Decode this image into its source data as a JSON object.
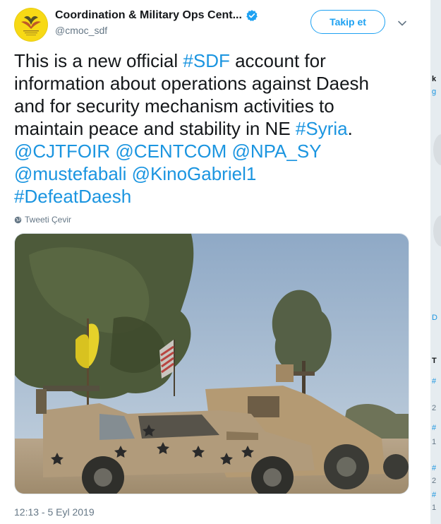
{
  "account": {
    "display_name": "Coordination & Military Ops Cent...",
    "handle": "@cmoc_sdf",
    "verified": true,
    "avatar_text": "Coordination & Military Ops Center"
  },
  "follow_button": {
    "label": "Takip et"
  },
  "icons": {
    "verified": "verified-badge-icon",
    "more": "chevron-down-icon",
    "translate": "globe-icon"
  },
  "tweet": {
    "lines": [
      [
        {
          "t": "This is a new official ",
          "link": false
        },
        {
          "t": "#SDF",
          "link": true
        },
        {
          "t": " account for",
          "link": false
        }
      ],
      [
        {
          "t": "information about operations against Daesh",
          "link": false
        }
      ],
      [
        {
          "t": "and for security mechanism activities to",
          "link": false
        }
      ],
      [
        {
          "t": "maintain peace and stability in NE ",
          "link": false
        },
        {
          "t": "#Syria",
          "link": true
        },
        {
          "t": ".",
          "link": false
        }
      ],
      [
        {
          "t": "@CJTFOIR",
          "link": true
        },
        {
          "t": " ",
          "link": false
        },
        {
          "t": "@CENTCOM",
          "link": true
        },
        {
          "t": " ",
          "link": false
        },
        {
          "t": "@NPA_SY",
          "link": true
        }
      ],
      [
        {
          "t": "@mustefabali",
          "link": true
        },
        {
          "t": " ",
          "link": false
        },
        {
          "t": "@KinoGabriel1",
          "link": true
        }
      ],
      [
        {
          "t": "#DefeatDaesh",
          "link": true
        }
      ]
    ],
    "translate_label": "Tweeti Çevir",
    "timestamp": "12:13 - 5 Eyl 2019"
  },
  "colors": {
    "link": "#1b95e0",
    "accent": "#1da1f2",
    "text": "#14171a",
    "muted": "#657786",
    "avatar_bg": "#f7d915"
  },
  "background_fragments": [
    "k",
    "g",
    "D",
    "T",
    "#",
    "2",
    "#",
    "1",
    "#",
    "2",
    "#",
    "1"
  ]
}
